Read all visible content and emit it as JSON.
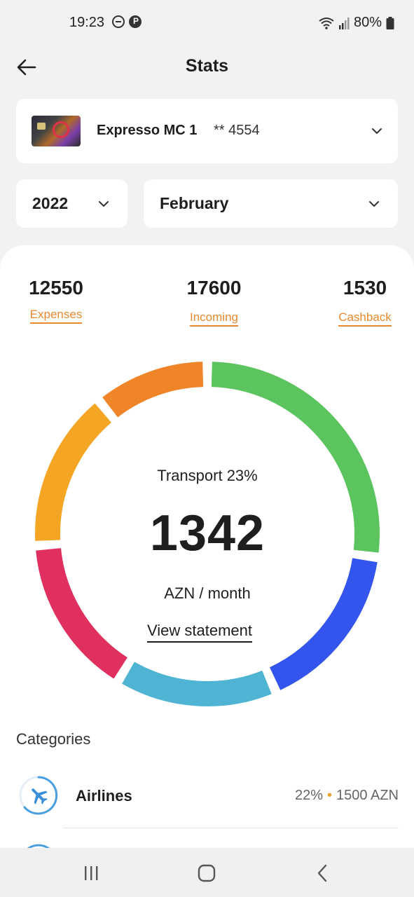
{
  "status_bar": {
    "time": "19:23",
    "battery": "80%"
  },
  "header": {
    "title": "Stats"
  },
  "card": {
    "name": "Expresso MC 1",
    "number": "** 4554"
  },
  "filters": {
    "year": "2022",
    "month": "February"
  },
  "summary": {
    "expenses": {
      "value": "12550",
      "label": "Expenses"
    },
    "incoming": {
      "value": "17600",
      "label": "Incoming"
    },
    "cashback": {
      "value": "1530",
      "label": "Cashback"
    }
  },
  "chart_data": {
    "type": "pie",
    "center_label": "Transport 23%",
    "center_value": "1342",
    "center_unit": "AZN / month",
    "segments": [
      {
        "color": "#5cc45f",
        "value": 25
      },
      {
        "color": "#3355ee",
        "value": 15
      },
      {
        "color": "#4fb3d3",
        "value": 14
      },
      {
        "color": "#e03060",
        "value": 14
      },
      {
        "color": "#f5a524",
        "value": 14
      },
      {
        "color": "#f08428",
        "value": 10
      }
    ]
  },
  "view_statement": "View statement",
  "categories": {
    "title": "Categories",
    "items": [
      {
        "name": "Airlines",
        "percent": "22%",
        "amount": "1500 AZN",
        "icon": "airplane-icon"
      }
    ]
  },
  "colors": {
    "accent": "#e8892d",
    "background": "#f2f2f2"
  }
}
